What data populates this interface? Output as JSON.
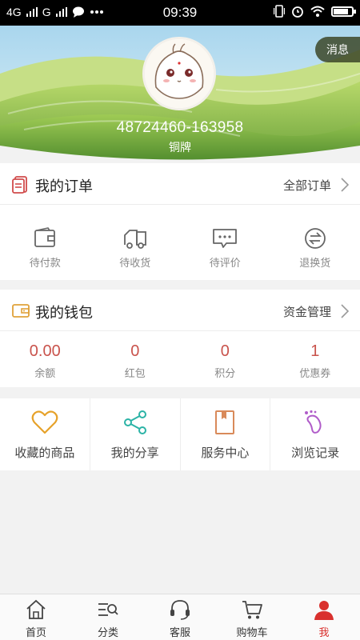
{
  "status_bar": {
    "network1": "4G",
    "network2": "G",
    "time": "09:39",
    "icons": [
      "signal-icon",
      "chat-icon",
      "more-icon",
      "vibrate-icon",
      "alarm-icon",
      "wifi-icon",
      "battery-icon"
    ]
  },
  "profile": {
    "message_label": "消息",
    "username": "48724460-163958",
    "level": "铜牌"
  },
  "orders": {
    "title": "我的订单",
    "all_label": "全部订单",
    "items": [
      {
        "label": "待付款",
        "icon": "wallet-icon"
      },
      {
        "label": "待收货",
        "icon": "truck-icon"
      },
      {
        "label": "待评价",
        "icon": "comment-icon"
      },
      {
        "label": "退换货",
        "icon": "exchange-icon"
      }
    ]
  },
  "wallet": {
    "title": "我的钱包",
    "manage_label": "资金管理",
    "items": [
      {
        "value": "0.00",
        "label": "余额"
      },
      {
        "value": "0",
        "label": "红包"
      },
      {
        "value": "0",
        "label": "积分"
      },
      {
        "value": "1",
        "label": "优惠券"
      }
    ]
  },
  "shortcuts": [
    {
      "label": "收藏的商品",
      "icon": "heart-icon",
      "color": "#e6a22a"
    },
    {
      "label": "我的分享",
      "icon": "share-icon",
      "color": "#2bb3a6"
    },
    {
      "label": "服务中心",
      "icon": "book-icon",
      "color": "#d98a5a"
    },
    {
      "label": "浏览记录",
      "icon": "footprint-icon",
      "color": "#b05cc9"
    }
  ],
  "tabbar": [
    {
      "label": "首页",
      "icon": "home-icon"
    },
    {
      "label": "分类",
      "icon": "category-icon"
    },
    {
      "label": "客服",
      "icon": "headset-icon"
    },
    {
      "label": "购物车",
      "icon": "cart-icon"
    },
    {
      "label": "我",
      "icon": "person-icon",
      "active": true
    }
  ],
  "colors": {
    "accent": "#d9312e",
    "wallet_value": "#c9534c",
    "hero_grass": "#6aa13a"
  }
}
